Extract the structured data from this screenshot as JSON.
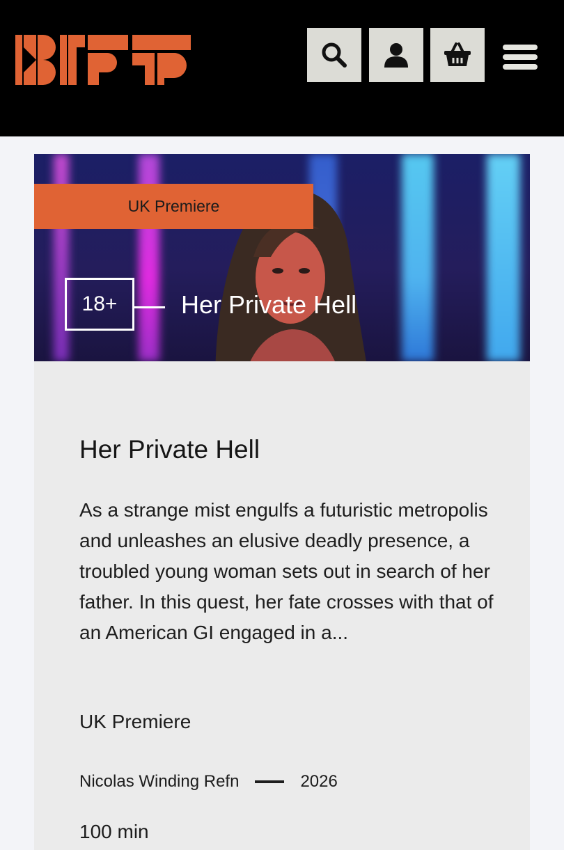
{
  "header": {
    "logo_text": "EIFF",
    "brand_color": "#e06334",
    "buttons": [
      {
        "name": "search-icon"
      },
      {
        "name": "user-icon"
      },
      {
        "name": "basket-icon"
      },
      {
        "name": "hamburger-menu-icon"
      }
    ]
  },
  "film": {
    "badge": "UK Premiere",
    "rating": "18+",
    "hero_title": "Her Private Hell",
    "title": "Her Private Hell",
    "synopsis": "As a strange mist engulfs a futuristic metropolis and unleashes an elusive deadly presence, a troubled young woman sets out in search of her father. In this quest, her fate crosses with that of an American GI engaged in a...",
    "premiere_label": "UK Premiere",
    "director": "Nicolas Winding Refn",
    "year": "2026",
    "runtime_partial": "100 min"
  }
}
